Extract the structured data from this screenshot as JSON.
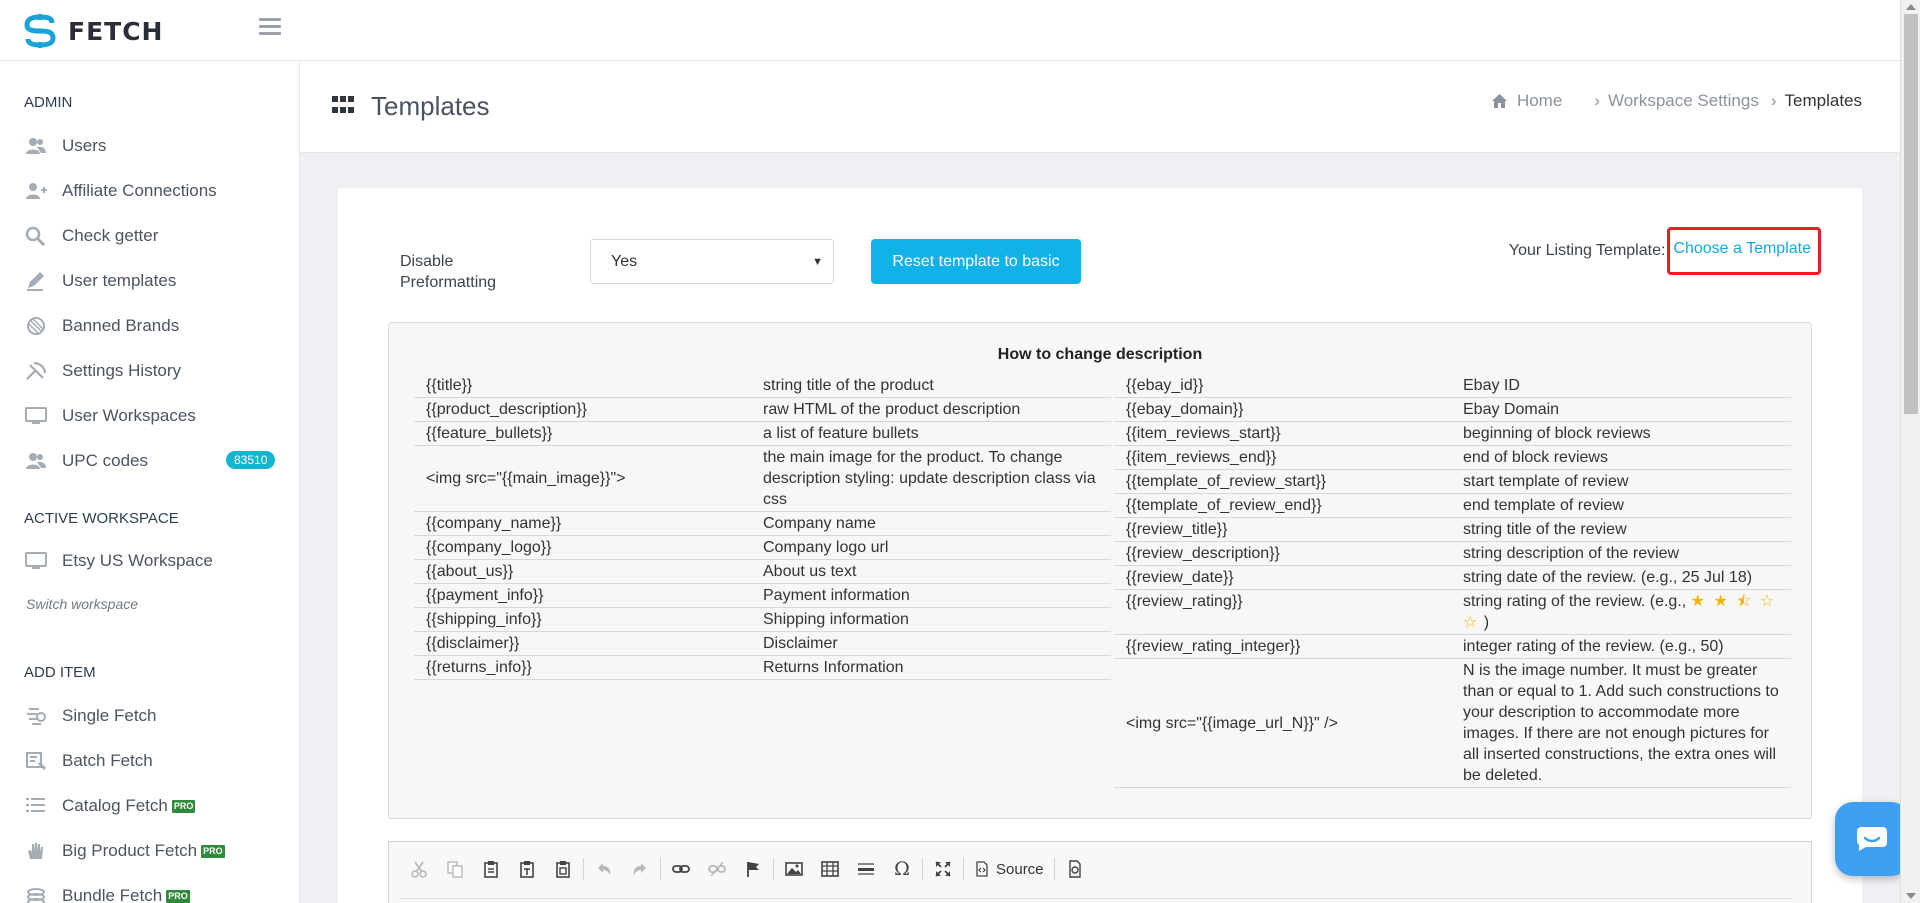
{
  "brand": {
    "name": "FETCH",
    "accent": "#1aa3d9"
  },
  "sidebar": {
    "sections": [
      {
        "label": "ADMIN"
      },
      {
        "label": "ACTIVE WORKSPACE"
      },
      {
        "label": "ADD ITEM"
      }
    ],
    "admin_items": [
      {
        "label": "Users",
        "icon": "users-icon"
      },
      {
        "label": "Affiliate Connections",
        "icon": "user-plus-icon"
      },
      {
        "label": "Check getter",
        "icon": "search-icon"
      },
      {
        "label": "User templates",
        "icon": "pencil-icon"
      },
      {
        "label": "Banned Brands",
        "icon": "shield-icon"
      },
      {
        "label": "Settings History",
        "icon": "history-icon"
      },
      {
        "label": "User Workspaces",
        "icon": "monitor-icon"
      },
      {
        "label": "UPC codes",
        "icon": "barcode-users-icon",
        "badge": "83510"
      }
    ],
    "workspace": {
      "label": "Etsy US Workspace",
      "icon": "monitor-icon",
      "switch_label": "Switch workspace"
    },
    "add_items": [
      {
        "label": "Single Fetch",
        "icon": "fetch-icon"
      },
      {
        "label": "Batch Fetch",
        "icon": "batch-icon"
      },
      {
        "label": "Catalog Fetch",
        "icon": "list-icon",
        "pro": "PRO"
      },
      {
        "label": "Big Product Fetch",
        "icon": "hand-icon",
        "pro": "PRO"
      },
      {
        "label": "Bundle Fetch",
        "icon": "bundle-icon",
        "pro": "PRO"
      }
    ]
  },
  "header": {
    "title": "Templates",
    "breadcrumb": {
      "home": "Home",
      "parent": "Workspace Settings",
      "current": "Templates"
    }
  },
  "settings": {
    "disable_preformatting_label": "Disable Preformatting",
    "select_value": "Yes",
    "reset_button": "Reset template to basic",
    "listing_label": "Your Listing Template:",
    "choose_link": "Choose a Template"
  },
  "help": {
    "title": "How to change description",
    "left_rows": [
      {
        "var": "{{title}}",
        "desc": "string title of the product"
      },
      {
        "var": "{{product_description}}",
        "desc": "raw HTML of the product description"
      },
      {
        "var": "{{feature_bullets}}",
        "desc": "a list of feature bullets"
      },
      {
        "var": "<img src=\"{{main_image}}\">",
        "desc": "the main image for the product. To change description styling: update description class via css"
      },
      {
        "var": "{{company_name}}",
        "desc": "Company name"
      },
      {
        "var": "{{company_logo}}",
        "desc": "Company logo url"
      },
      {
        "var": "{{about_us}}",
        "desc": "About us text"
      },
      {
        "var": "{{payment_info}}",
        "desc": "Payment information"
      },
      {
        "var": "{{shipping_info}}",
        "desc": "Shipping information"
      },
      {
        "var": "{{disclaimer}}",
        "desc": "Disclaimer"
      },
      {
        "var": "{{returns_info}}",
        "desc": "Returns Information"
      }
    ],
    "right_rows": [
      {
        "var": "{{ebay_id}}",
        "desc": "Ebay ID"
      },
      {
        "var": "{{ebay_domain}}",
        "desc": "Ebay Domain"
      },
      {
        "var": "{{item_reviews_start}}",
        "desc": "beginning of block reviews"
      },
      {
        "var": "{{item_reviews_end}}",
        "desc": "end of block reviews"
      },
      {
        "var": "{{template_of_review_start}}",
        "desc": "start template of review"
      },
      {
        "var": "{{template_of_review_end}}",
        "desc": "end template of review"
      },
      {
        "var": "{{review_title}}",
        "desc": "string title of the review"
      },
      {
        "var": "{{review_description}}",
        "desc": "string description of the review"
      },
      {
        "var": "{{review_date}}",
        "desc": "string date of the review. (e.g., 25 Jul 18)"
      },
      {
        "var": "{{review_rating}}",
        "desc": "string rating of the review. (e.g.,",
        "stars": "★ ★ ⯪ ☆ ☆",
        "desc_end": ")"
      },
      {
        "var": "{{review_rating_integer}}",
        "desc": "integer rating of the review. (e.g., 50)"
      },
      {
        "var": "<img src=\"{{image_url_N}}\" />",
        "desc": "N is the image number. It must be greater than or equal to 1. Add such constructions to your description to accommodate more images. If there are not enough pictures for all inserted constructions, the extra ones will be deleted."
      }
    ]
  },
  "editor": {
    "source_label": "Source",
    "tools": [
      "cut-icon",
      "copy-icon",
      "paste-icon",
      "paste-text-icon",
      "paste-word-icon",
      "undo-icon",
      "redo-icon",
      "link-icon",
      "unlink-icon",
      "anchor-icon",
      "image-icon",
      "table-icon",
      "horizontal-line-icon",
      "special-char-icon",
      "maximize-icon",
      "source-icon",
      "template-icon"
    ]
  }
}
